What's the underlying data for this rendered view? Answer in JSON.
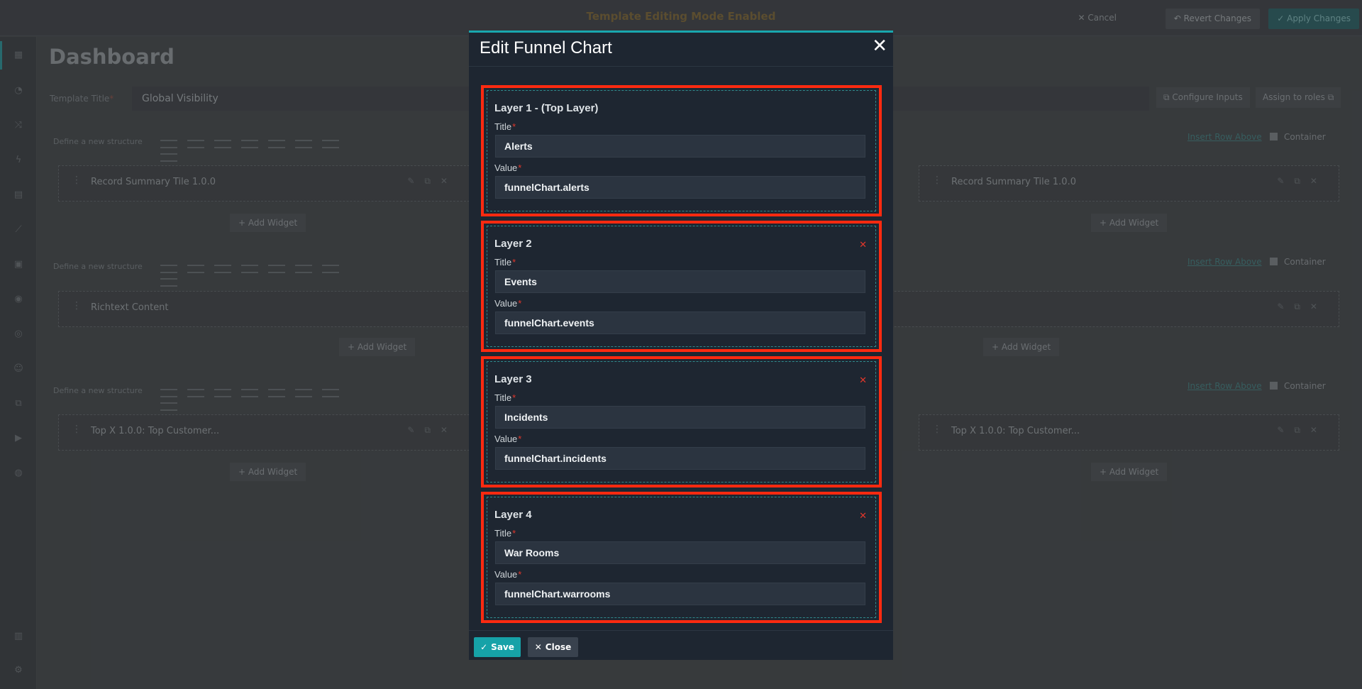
{
  "topbar": {
    "mode_text": "Template Editing Mode Enabled",
    "cancel_label": "Cancel",
    "revert_label": "Revert Changes",
    "apply_label": "Apply Changes"
  },
  "page": {
    "title": "Dashboard",
    "template_title_label": "Template Title",
    "template_title_value": "Global Visibility",
    "configure_inputs_label": "Configure Inputs",
    "assign_roles_label": "Assign to roles"
  },
  "structure": {
    "define_label": "Define a new structure",
    "insert_row_label": "Insert Row Above",
    "container_label": "Container",
    "add_widget_label": "Add Widget"
  },
  "rows": [
    {
      "left_widget": "Record Summary Tile 1.0.0",
      "right_widget": "Record Summary Tile 1.0.0"
    },
    {
      "left_widget": "Richtext Content"
    },
    {
      "left_widget": "Top X 1.0.0: Top Customer...",
      "right_widget": "Top X 1.0.0: Top Customer..."
    }
  ],
  "modal": {
    "title": "Edit Funnel Chart",
    "close_glyph": "✕",
    "title_label": "Title",
    "value_label": "Value",
    "required_mark": "*",
    "remove_glyph": "✕",
    "save_label": "Save",
    "close_label": "Close",
    "layers": [
      {
        "name": "Layer 1 - (Top Layer)",
        "title": "Alerts",
        "value": "funnelChart.alerts"
      },
      {
        "name": "Layer 2",
        "title": "Events",
        "value": "funnelChart.events"
      },
      {
        "name": "Layer 3",
        "title": "Incidents",
        "value": "funnelChart.incidents"
      },
      {
        "name": "Layer 4",
        "title": "War Rooms",
        "value": "funnelChart.warrooms"
      }
    ]
  }
}
